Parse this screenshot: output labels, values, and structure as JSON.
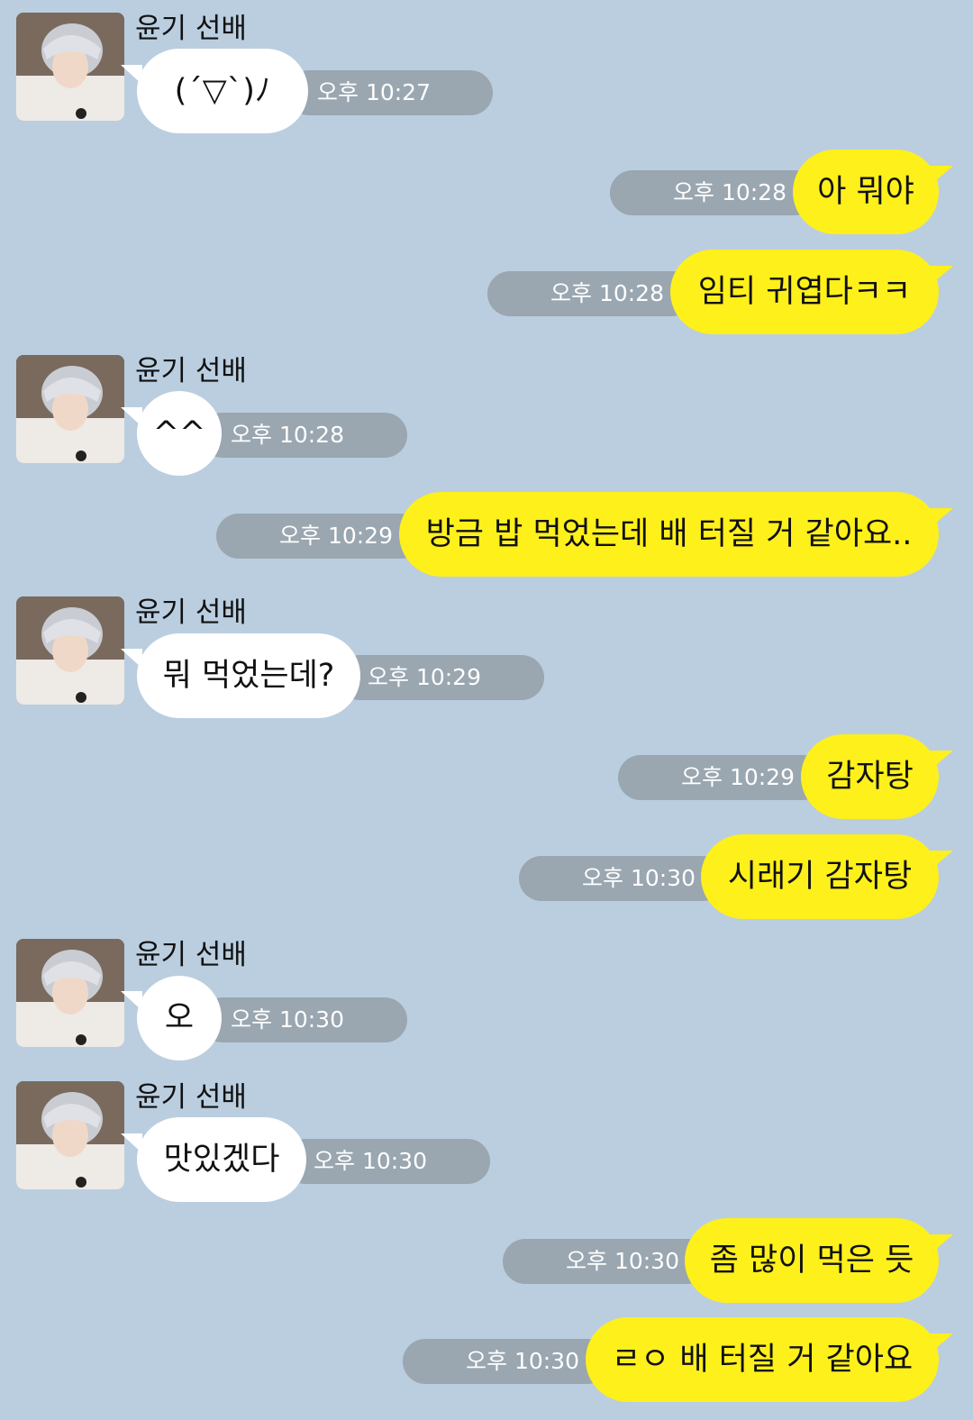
{
  "chat": {
    "colors": {
      "background": "#bacee0",
      "incoming_bubble": "#ffffff",
      "outgoing_bubble": "#fef01b",
      "time_pill": "#9aa6b0"
    },
    "messages": [
      {
        "sender": "윤기 선배",
        "text": "(´▽`)ﾉ",
        "time": "오후 10:27"
      },
      {
        "text": "아 뭐야",
        "time": "오후 10:28"
      },
      {
        "text": "임티 귀엽다ㅋㅋ",
        "time": "오후 10:28"
      },
      {
        "sender": "윤기 선배",
        "text": "^^",
        "time": "오후 10:28"
      },
      {
        "text": "방금 밥 먹었는데 배 터질 거 같아요..",
        "time": "오후 10:29"
      },
      {
        "sender": "윤기 선배",
        "text": "뭐 먹었는데?",
        "time": "오후 10:29"
      },
      {
        "text": "감자탕",
        "time": "오후 10:29"
      },
      {
        "text": "시래기 감자탕",
        "time": "오후 10:30"
      },
      {
        "sender": "윤기 선배",
        "text": "오",
        "time": "오후 10:30"
      },
      {
        "sender": "윤기 선배",
        "text": "맛있겠다",
        "time": "오후 10:30"
      },
      {
        "text": "좀 많이 먹은 듯",
        "time": "오후 10:30"
      },
      {
        "text": "ㄹㅇ 배 터질 거 같아요",
        "time": "오후 10:30"
      }
    ]
  }
}
